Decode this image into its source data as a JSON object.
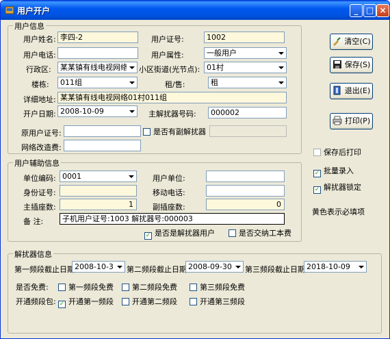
{
  "window": {
    "title": "用户开户"
  },
  "user_info": {
    "legend": "用户信息",
    "name_label": "用户姓名:",
    "name_value": "李四-2",
    "cert_label": "用户证号:",
    "cert_value": "1002",
    "phone_label": "用户电话:",
    "phone_value": "",
    "attr_label": "用户属性:",
    "attr_value": "一般用户",
    "district_label": "行政区:",
    "district_value": "某某镇有线电视网络",
    "street_label": "小区街道(光节点):",
    "street_value": "01村",
    "building_label": "楼栋:",
    "building_value": "011组",
    "rent_label": "租/售:",
    "rent_value": "租",
    "address_label": "详细地址:",
    "address_value": "某某镇有线电视网络01村011组",
    "open_date_label": "开户日期:",
    "open_date_value": "2008-10-09",
    "descrambler_label": "主解扰器号码:",
    "descrambler_value": "000002",
    "orig_cert_label": "原用户证号:",
    "orig_cert_value": "",
    "sub_descrambler_label": "是否有副解扰器",
    "sub_descrambler_value": "",
    "network_fee_label": "网络改造费:",
    "network_fee_value": ""
  },
  "aux_info": {
    "legend": "用户辅助信息",
    "unit_code_label": "单位编码:",
    "unit_code_value": "0001",
    "unit_label": "用户单位:",
    "unit_value": "",
    "id_label": "身份证号:",
    "id_value": "",
    "mobile_label": "移动电话:",
    "mobile_value": "",
    "main_sockets_label": "主插座数:",
    "main_sockets_value": "1",
    "sub_sockets_label": "副插座数:",
    "sub_sockets_value": "0",
    "remark_label": "备  注:",
    "remark_value": "子机用户证号:1003 解扰器号:000003",
    "is_descrambler_user_label": "是否是解扰器用户",
    "is_descrambler_user_checked": true,
    "paid_fee_label": "是否交纳工本费",
    "paid_fee_checked": false
  },
  "descrambler_info": {
    "legend": "解扰器信息",
    "band1_label": "第一频段截止日期:",
    "band1_value": "2008-10-31",
    "band2_label": "第二频段截止日期:",
    "band2_value": "2008-09-30",
    "band3_label": "第三频段截止日期:",
    "band3_value": "2018-10-09",
    "free_label": "是否免费:",
    "free1_label": "第一频段免费",
    "free1_checked": false,
    "free2_label": "第二频段免费",
    "free2_checked": false,
    "free3_label": "第三频段免费",
    "free3_checked": false,
    "open_label": "开通频段包:",
    "open1_label": "开通第一频段",
    "open1_checked": true,
    "open2_label": "开通第二频段",
    "open2_checked": false,
    "open3_label": "开通第三频段",
    "open3_checked": false
  },
  "actions": {
    "clear_label": "清空(C)",
    "save_label": "保存(S)",
    "exit_label": "退出(E)",
    "print_label": "打印(P)",
    "print_after_save_label": "保存后打印",
    "print_after_save_checked": false,
    "batch_label": "批量录入",
    "batch_checked": true,
    "lock_label": "解扰器锁定",
    "lock_checked": true,
    "required_note": "黄色表示必填项"
  }
}
